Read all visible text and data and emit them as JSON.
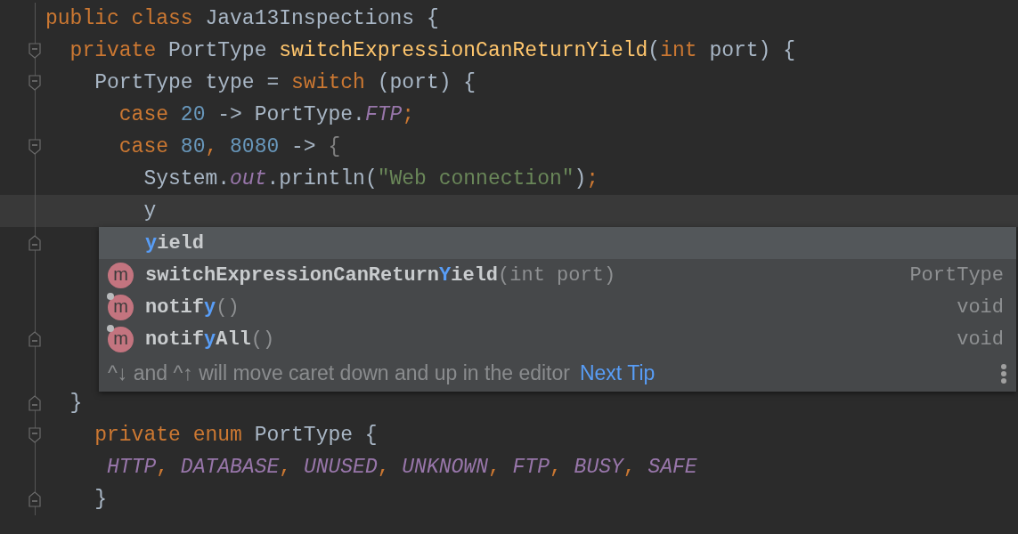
{
  "editor": {
    "lines": [
      {
        "kind": "plain",
        "current": false,
        "tokens": [
          {
            "kind": "keyword",
            "text": "public class "
          },
          {
            "kind": "plain",
            "text": "Java13Inspections {"
          }
        ]
      },
      {
        "kind": "fold_start",
        "current": false,
        "tokens": [
          {
            "kind": "keyword",
            "text": "  private "
          },
          {
            "kind": "plain",
            "text": "PortType "
          },
          {
            "kind": "method",
            "text": "switchExpressionCanReturnYield"
          },
          {
            "kind": "plain",
            "text": "("
          },
          {
            "kind": "keyword",
            "text": "int "
          },
          {
            "kind": "plain",
            "text": "port) {"
          }
        ]
      },
      {
        "kind": "fold_start",
        "current": false,
        "tokens": [
          {
            "kind": "plain",
            "text": "    PortType type = "
          },
          {
            "kind": "keyword",
            "text": "switch "
          },
          {
            "kind": "plain",
            "text": "(port) {"
          }
        ]
      },
      {
        "kind": "plain",
        "current": false,
        "tokens": [
          {
            "kind": "keyword",
            "text": "      case "
          },
          {
            "kind": "number",
            "text": "20 "
          },
          {
            "kind": "plain",
            "text": "-> PortType."
          },
          {
            "kind": "constant",
            "text": "FTP"
          },
          {
            "kind": "keyword",
            "text": ";"
          }
        ]
      },
      {
        "kind": "fold_start",
        "current": false,
        "tokens": [
          {
            "kind": "keyword",
            "text": "      case "
          },
          {
            "kind": "number",
            "text": "80"
          },
          {
            "kind": "keyword",
            "text": ", "
          },
          {
            "kind": "number",
            "text": "8080 "
          },
          {
            "kind": "plain",
            "text": "-> "
          },
          {
            "kind": "brace",
            "text": "{"
          }
        ]
      },
      {
        "kind": "plain",
        "current": false,
        "tokens": [
          {
            "kind": "plain",
            "text": "        System."
          },
          {
            "kind": "constant",
            "text": "out"
          },
          {
            "kind": "plain",
            "text": ".println("
          },
          {
            "kind": "string",
            "text": "\"Web connection\""
          },
          {
            "kind": "plain",
            "text": ")"
          },
          {
            "kind": "keyword",
            "text": ";"
          }
        ]
      },
      {
        "kind": "plain",
        "current": true,
        "tokens": [
          {
            "kind": "plain",
            "text": "        y"
          }
        ]
      },
      {
        "kind": "fold_end",
        "current": false
      },
      {
        "kind": "plain",
        "current": false
      },
      {
        "kind": "plain",
        "current": false
      },
      {
        "kind": "fold_end",
        "current": false
      },
      {
        "kind": "plain",
        "current": false
      },
      {
        "kind": "fold_end",
        "current": false,
        "tokens": [
          {
            "kind": "plain",
            "text": "  }"
          }
        ]
      },
      {
        "kind": "fold_start",
        "current": false,
        "tokens": [
          {
            "kind": "keyword",
            "text": "    private enum "
          },
          {
            "kind": "plain",
            "text": "PortType {"
          }
        ]
      },
      {
        "kind": "plain",
        "current": false,
        "tokens": [
          {
            "kind": "constant",
            "text": "     HTTP"
          },
          {
            "kind": "keyword",
            "text": ", "
          },
          {
            "kind": "constant",
            "text": "DATABASE"
          },
          {
            "kind": "keyword",
            "text": ", "
          },
          {
            "kind": "constant",
            "text": "UNUSED"
          },
          {
            "kind": "keyword",
            "text": ", "
          },
          {
            "kind": "constant",
            "text": "UNKNOWN"
          },
          {
            "kind": "keyword",
            "text": ", "
          },
          {
            "kind": "constant",
            "text": "FTP"
          },
          {
            "kind": "keyword",
            "text": ", "
          },
          {
            "kind": "constant",
            "text": "BUSY"
          },
          {
            "kind": "keyword",
            "text": ", "
          },
          {
            "kind": "constant",
            "text": "SAFE"
          }
        ]
      },
      {
        "kind": "fold_end",
        "current": false,
        "tokens": [
          {
            "kind": "plain",
            "text": "    }"
          }
        ]
      }
    ]
  },
  "completion": {
    "items": [
      {
        "kind": "keyword",
        "selected": true,
        "name": [
          {
            "text": "y",
            "match": true
          },
          {
            "text": "ield",
            "match": false
          }
        ]
      },
      {
        "kind": "method",
        "selected": false,
        "icon_letter": "m",
        "badge": false,
        "name": [
          {
            "text": "switchExpressionCanReturn",
            "match": false
          },
          {
            "text": "Y",
            "match": true
          },
          {
            "text": "ield",
            "match": false
          }
        ],
        "params": "(int port)",
        "type": "PortType"
      },
      {
        "kind": "method",
        "selected": false,
        "icon_letter": "m",
        "badge": true,
        "name": [
          {
            "text": "notif",
            "match": false
          },
          {
            "text": "y",
            "match": true
          }
        ],
        "params": "()",
        "type": "void"
      },
      {
        "kind": "method",
        "selected": false,
        "icon_letter": "m",
        "badge": true,
        "name": [
          {
            "text": "notif",
            "match": false
          },
          {
            "text": "y",
            "match": true
          },
          {
            "text": "All",
            "match": false
          }
        ],
        "params": "()",
        "type": "void"
      }
    ],
    "hint": {
      "text": "^↓ and ^↑ will move caret down and up in the editor",
      "link": "Next Tip"
    }
  }
}
